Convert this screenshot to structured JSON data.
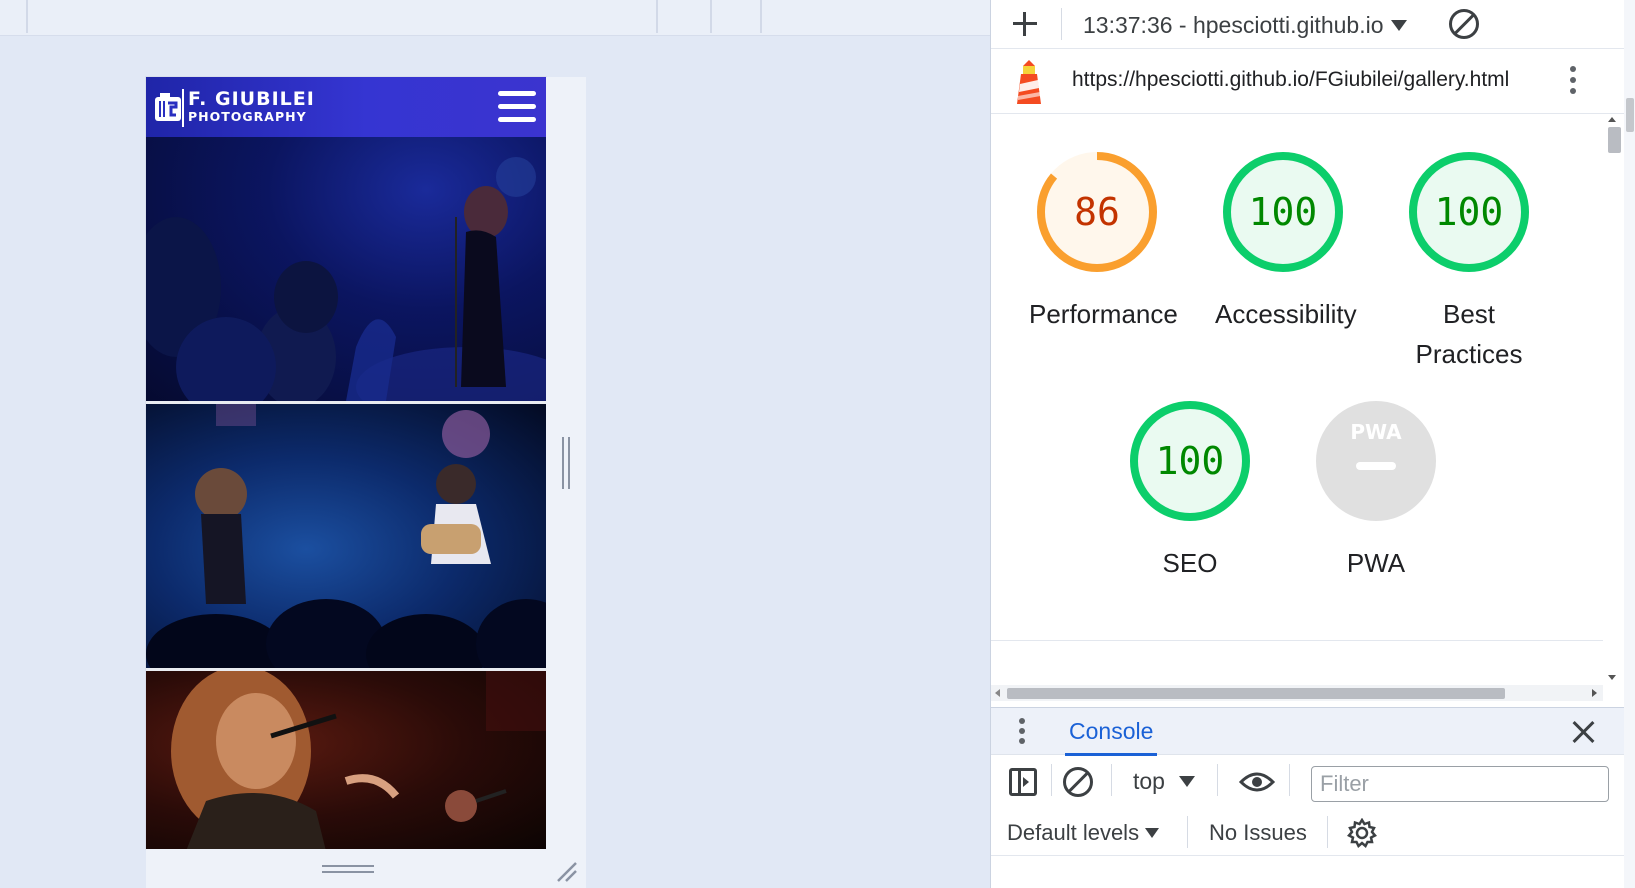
{
  "device_page": {
    "logo": {
      "line1": "F. GIUBILEI",
      "line2": "PHOTOGRAPHY"
    },
    "menu_icon": "hamburger-menu-icon",
    "photos": [
      {
        "name": "concert-photo-1"
      },
      {
        "name": "concert-photo-2"
      },
      {
        "name": "concert-photo-3"
      }
    ]
  },
  "devtools": {
    "report_selector": "13:37:36 - hpesciotti.github.io",
    "url": "https://hpesciotti.github.io/FGiubilei/gallery.html",
    "scores": [
      {
        "label": "Performance",
        "score": "86",
        "value": 86,
        "color": "#fa9f2e",
        "text_color": "#c33300",
        "fill": "#fff7ec"
      },
      {
        "label": "Accessibility",
        "score": "100",
        "value": 100,
        "color": "#0cce6b",
        "text_color": "#008800",
        "fill": "#eafaf1"
      },
      {
        "label": "Best Practices",
        "score": "100",
        "value": 100,
        "color": "#0cce6b",
        "text_color": "#008800",
        "fill": "#eafaf1"
      },
      {
        "label": "SEO",
        "score": "100",
        "value": 100,
        "color": "#0cce6b",
        "text_color": "#008800",
        "fill": "#eafaf1"
      },
      {
        "label": "PWA",
        "score": "",
        "value": null,
        "color": "#e0e0e0",
        "text_color": "#ffffff",
        "fill": "#e0e0e0",
        "badge": "PWA"
      }
    ],
    "drawer": {
      "tab": "Console",
      "context": "top",
      "filter_placeholder": "Filter",
      "levels": "Default levels",
      "issues": "No Issues"
    }
  }
}
